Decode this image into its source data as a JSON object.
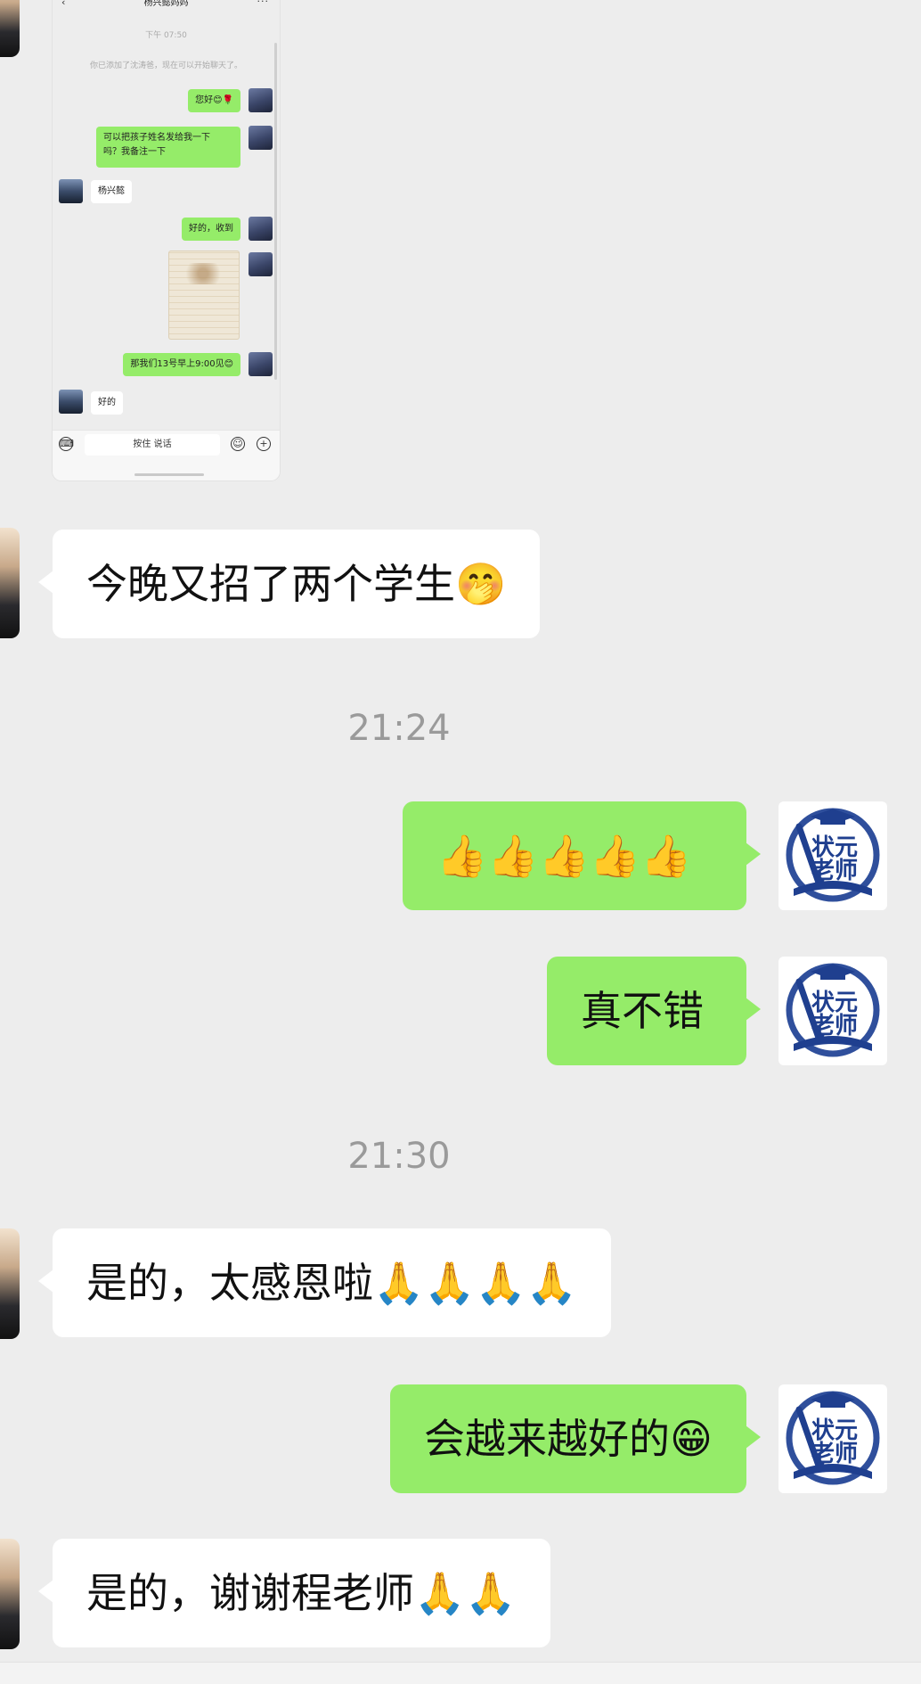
{
  "screenshot": {
    "title": "杨兴懿妈妈",
    "back_icon": "‹",
    "more_icon": "···",
    "time": "下午 07:50",
    "system_notice": "你已添加了沈涛爸，现在可以开始聊天了。",
    "messages": [
      {
        "side": "right",
        "text": "您好😊🌹"
      },
      {
        "side": "right",
        "text": "可以把孩子姓名发给我一下\n吗？我备注一下"
      },
      {
        "side": "left",
        "text": "杨兴懿"
      },
      {
        "side": "right",
        "text": "好的，收到"
      },
      {
        "side": "right",
        "text": "那我们13号早上9:00见😊"
      },
      {
        "side": "left",
        "text": "好的"
      }
    ],
    "input_placeholder": "按住 说话"
  },
  "chat": {
    "messages": [
      {
        "side": "left",
        "text": "今晚又招了两个学生🤭"
      },
      {
        "timestamp": "21:24"
      },
      {
        "side": "right",
        "text": "👍👍👍👍👍"
      },
      {
        "side": "right",
        "text": "真不错"
      },
      {
        "timestamp": "21:30"
      },
      {
        "side": "left",
        "text": "是的，太感恩啦🙏🙏🙏🙏"
      },
      {
        "side": "right",
        "text": "会越来越好的😁"
      },
      {
        "side": "left",
        "text": "是的，谢谢程老师🙏🙏"
      }
    ]
  },
  "teacher_avatar": {
    "line1": "状元",
    "line2": "老师",
    "colors": {
      "navy": "#1f3f8f",
      "ring": "#2f4f9c"
    }
  },
  "colors": {
    "background": "#ededed",
    "self_bubble": "#95ec69",
    "other_bubble": "#ffffff",
    "timestamp": "#9a9a9a"
  }
}
